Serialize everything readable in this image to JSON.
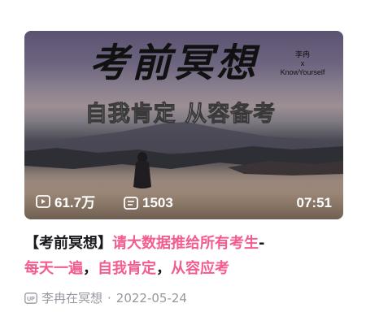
{
  "thumbnail": {
    "main_title": "考前冥想",
    "collab_line1": "李冉",
    "collab_line2": "x",
    "collab_line3": "KnowYourself",
    "subtitle": "自我肯定 从容备考"
  },
  "stats": {
    "views": "61.7万",
    "danmaku": "1503",
    "duration": "07:51",
    "views_icon": "play-icon",
    "danmaku_icon": "danmaku-icon"
  },
  "title": {
    "part1": "【考前冥想】",
    "part2": "请大数据推给所有考生",
    "part3": "-",
    "part4": "每天一遍",
    "part5": "，",
    "part6": "自我肯定",
    "part7": "，",
    "part8": "从容应考",
    "highlight_color": "#f25d8e"
  },
  "meta": {
    "up_icon": "up-badge-icon",
    "author": "李冉在冥想",
    "separator": "·",
    "date": "2022-05-24"
  }
}
